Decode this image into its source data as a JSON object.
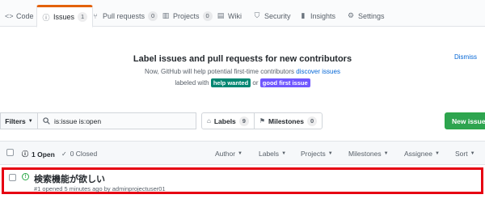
{
  "tabs": [
    {
      "label": "Code",
      "icon": "<>"
    },
    {
      "label": "Issues",
      "icon": "issue-icon",
      "count": "1"
    },
    {
      "label": "Pull requests",
      "icon": "pr-icon",
      "count": "0"
    },
    {
      "label": "Projects",
      "icon": "project-icon",
      "count": "0"
    },
    {
      "label": "Wiki",
      "icon": "book-icon"
    },
    {
      "label": "Security",
      "icon": "shield-icon"
    },
    {
      "label": "Insights",
      "icon": "graph-icon"
    },
    {
      "label": "Settings",
      "icon": "gear-icon"
    }
  ],
  "banner": {
    "title": "Label issues and pull requests for new contributors",
    "line1_prefix": "Now, GitHub will help potential first-time contributors",
    "line1_link": "discover issues",
    "line2_prefix": "labeled with",
    "label1": "help wanted",
    "label1_color": "#008672",
    "line2_or": "or",
    "label2": "good first issue",
    "label2_color": "#7057ff",
    "dismiss": "Dismiss"
  },
  "filter_bar": {
    "filters_label": "Filters",
    "search_value": "is:issue is:open",
    "labels_label": "Labels",
    "labels_count": "9",
    "milestones_label": "Milestones",
    "milestones_count": "0",
    "new_issue_label": "New issue"
  },
  "issues_header": {
    "open_label": "1 Open",
    "closed_label": "0 Closed",
    "filters": [
      "Author",
      "Labels",
      "Projects",
      "Milestones",
      "Assignee",
      "Sort"
    ]
  },
  "issues": [
    {
      "title": "検索機能が欲しい",
      "meta": "#1 opened 5 minutes ago by adminprojectuser01"
    }
  ],
  "colors": {
    "accent_tab": "#e36209",
    "new_issue_green": "#2ea44f",
    "open_green": "#28a745",
    "highlight_red": "#e60012",
    "link_blue": "#0366d6"
  }
}
